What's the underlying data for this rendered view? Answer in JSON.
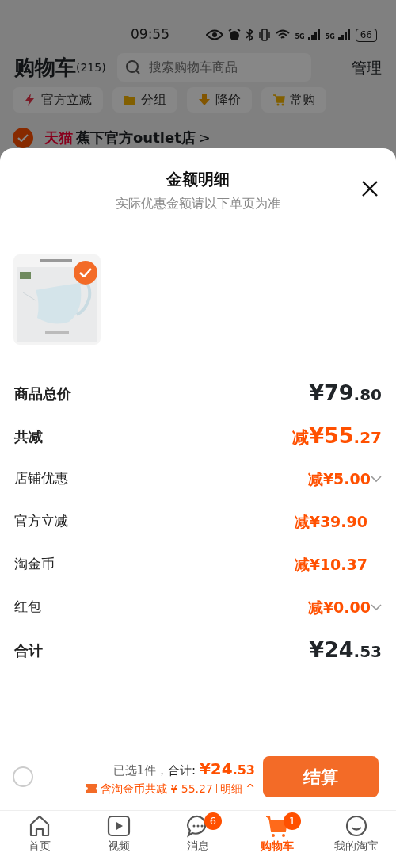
{
  "status_bar": {
    "time": "09:55",
    "network": [
      "5G",
      "5G"
    ],
    "battery": "66"
  },
  "header": {
    "title": "购物车",
    "count": "(215)",
    "search": {
      "placeholder": "搜索购物车商品"
    },
    "manage": "管理"
  },
  "filters": [
    {
      "label": "官方立减",
      "kind": "bolt"
    },
    {
      "label": "分组",
      "kind": "folder"
    },
    {
      "label": "降价",
      "kind": "down"
    },
    {
      "label": "常购",
      "kind": "cart"
    }
  ],
  "shop": {
    "checked": true,
    "platform": "天猫",
    "name": "蕉下官方outlet店",
    "chevron": ">"
  },
  "sheet": {
    "title": "金额明细",
    "subtitle": "实际优惠金额请以下单页为准",
    "product": {
      "selected": true
    },
    "rows": [
      {
        "label": "商品总价",
        "prefix": "",
        "amount": "¥79.80",
        "kind": "total",
        "expandable": false
      },
      {
        "label": "共减",
        "prefix": "减",
        "amount": "¥55.27",
        "kind": "discount_total",
        "expandable": false
      },
      {
        "label": "店铺优惠",
        "prefix": "减",
        "amount": "¥5.00",
        "kind": "discount",
        "expandable": true
      },
      {
        "label": "官方立减",
        "prefix": "减",
        "amount": "¥39.90",
        "kind": "discount",
        "expandable": false
      },
      {
        "label": "淘金币",
        "prefix": "减",
        "amount": "¥10.37",
        "kind": "discount",
        "expandable": false
      },
      {
        "label": "红包",
        "prefix": "减",
        "amount": "¥0.00",
        "kind": "discount",
        "expandable": true
      },
      {
        "label": "合计",
        "prefix": "",
        "amount": "¥24.53",
        "kind": "total",
        "expandable": false
      }
    ]
  },
  "checkout": {
    "select_all": {
      "checked": false
    },
    "selected_count": "已选1件，",
    "total_label": "合计:",
    "total": "¥24.53",
    "saving": "含淘金币共减 ¥ 55.27",
    "detail": "明细 ^",
    "button": "结算"
  },
  "tabbar": [
    {
      "label": "首页",
      "kind": "home",
      "selected": false
    },
    {
      "label": "视频",
      "kind": "video",
      "selected": false
    },
    {
      "label": "消息",
      "kind": "chat",
      "selected": false,
      "badge": "6"
    },
    {
      "label": "购物车",
      "kind": "cart",
      "selected": true,
      "badge": "1"
    },
    {
      "label": "我的淘宝",
      "kind": "smile",
      "selected": false
    }
  ]
}
